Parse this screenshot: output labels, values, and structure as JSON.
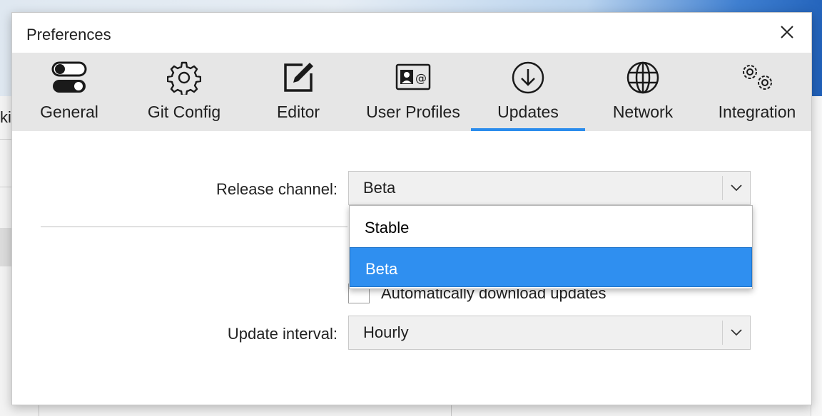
{
  "background": {
    "partial_text": "ki"
  },
  "dialog": {
    "title": "Preferences",
    "tabs": [
      {
        "label": "General",
        "icon": "toggle-switch-icon"
      },
      {
        "label": "Git Config",
        "icon": "gear-icon"
      },
      {
        "label": "Editor",
        "icon": "edit-icon"
      },
      {
        "label": "User Profiles",
        "icon": "contact-card-icon"
      },
      {
        "label": "Updates",
        "icon": "download-circle-icon"
      },
      {
        "label": "Network",
        "icon": "globe-icon"
      },
      {
        "label": "Integration",
        "icon": "gears-icon"
      }
    ],
    "active_tab": "Updates",
    "release_channel": {
      "label": "Release channel:",
      "value": "Beta",
      "options": [
        "Stable",
        "Beta"
      ],
      "highlighted": "Beta"
    },
    "auto_download": {
      "label": "Automatically download updates",
      "checked": false
    },
    "update_interval": {
      "label": "Update interval:",
      "value": "Hourly"
    }
  },
  "colors": {
    "accent": "#2b8cec",
    "selection": "#2f8ff0",
    "tabbar": "#e6e6e6"
  }
}
